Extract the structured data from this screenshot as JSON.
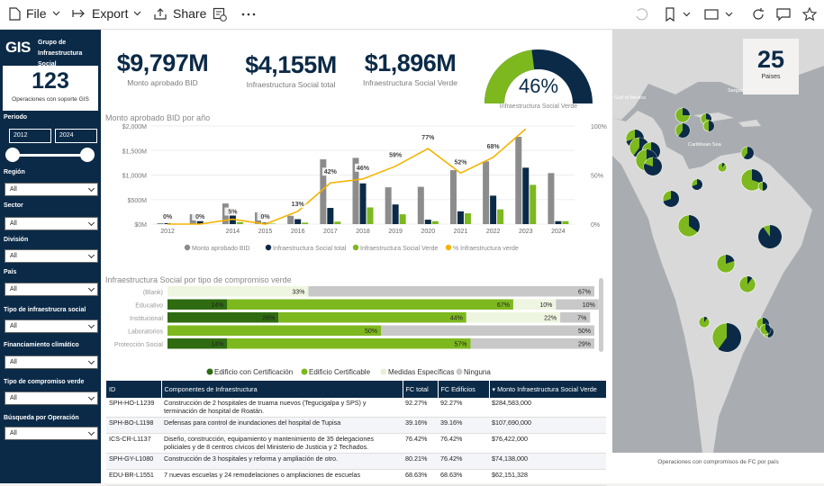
{
  "toolbar": {
    "file": "File",
    "export": "Export",
    "share": "Share"
  },
  "sidebar": {
    "logo": "GIS",
    "group": "Grupo de Infraestructura Social",
    "ops_value": "123",
    "ops_label": "Operaciones con soporte GIS",
    "periodo": "Periodo",
    "year_from": "2012",
    "year_to": "2024",
    "filters": [
      {
        "label": "Región",
        "value": "All"
      },
      {
        "label": "Sector",
        "value": "All"
      },
      {
        "label": "División",
        "value": "All"
      },
      {
        "label": "País",
        "value": "All"
      },
      {
        "label": "Tipo de infraestrucra social",
        "value": "All"
      },
      {
        "label": "Financiamiento climático",
        "value": "All"
      },
      {
        "label": "Tipo de compromiso verde",
        "value": "All"
      },
      {
        "label": "Búsqueda por Operación",
        "value": "All"
      }
    ]
  },
  "kpis": [
    {
      "value": "$9,797M",
      "label": "Monto aprobado BID"
    },
    {
      "value": "$4,155M",
      "label": "Infraestructura Social total"
    },
    {
      "value": "$1,896M",
      "label": "Infraestructura Social Verde"
    }
  ],
  "gauge": {
    "value": "46%",
    "label": "Infraestructura Social Verde",
    "fraction": 0.46
  },
  "bar_title": "Monto aprobado BID por año",
  "stack_title": "Infraestructura Social por tipo de compromiso verde",
  "map": {
    "count": "25",
    "count_label": "Paises",
    "caption": "Operaciones con compromisos de FC por país",
    "labels": [
      "Gulf of Mexico",
      "Sargasso Sea",
      "Caribbean Sea"
    ]
  },
  "colors": {
    "gray": "#8c8c8c",
    "navy": "#0b2a47",
    "green": "#7db81f",
    "orange": "#f4b400",
    "dkgreen": "#2f6b10",
    "pale": "#eef5e0",
    "lightgray": "#c8c8c8"
  },
  "chart_data": [
    {
      "type": "bar",
      "title": "Monto aprobado BID por año",
      "categories": [
        "2012",
        "2013",
        "2014",
        "2015",
        "2016",
        "2017",
        "2018",
        "2019",
        "2020",
        "2021",
        "2022",
        "2023",
        "2024"
      ],
      "x_tick_labels": [
        "2012",
        "2014",
        "2015",
        "2016",
        "2017",
        "2018",
        "2019",
        "2020",
        "2021",
        "2022",
        "2023",
        "2024"
      ],
      "y_ticks": [
        "$0M",
        "$500M",
        "$1,000M",
        "$1,500M",
        "$2,000M"
      ],
      "y2_ticks": [
        "0%",
        "50%",
        "100%"
      ],
      "ylim": [
        0,
        2000
      ],
      "series": [
        {
          "name": "Monto aprobado BID",
          "values": [
            20,
            200,
            420,
            240,
            170,
            1320,
            1350,
            750,
            760,
            1100,
            1280,
            1780,
            1040
          ]
        },
        {
          "name": "Infraestructura Social total",
          "values": [
            20,
            60,
            180,
            30,
            100,
            330,
            830,
            400,
            90,
            260,
            580,
            1150,
            60
          ]
        },
        {
          "name": "Infraestructura Social Verde",
          "values": [
            0,
            0,
            40,
            10,
            30,
            50,
            340,
            200,
            60,
            220,
            300,
            800,
            60
          ]
        },
        {
          "name": "% Infraestructura verde",
          "values": [
            0,
            0,
            5,
            0,
            13,
            42,
            46,
            59,
            77,
            52,
            68,
            97,
            null
          ]
        }
      ],
      "pct_labels": [
        "0%",
        "0%",
        "5%",
        "0%",
        "13%",
        "42%",
        "46%",
        "59%",
        "77%",
        "52%",
        "68%",
        "97%"
      ]
    },
    {
      "type": "bar",
      "title": "Infraestructura Social por tipo de compromiso verde",
      "categories": [
        "(Blank)",
        "Educativo",
        "Institucional",
        "Laboratorios",
        "Protección Social"
      ],
      "series": [
        {
          "name": "Edificio con Certificación",
          "values": [
            0,
            14,
            26,
            0,
            14
          ]
        },
        {
          "name": "Edificio Certificable",
          "values": [
            0,
            67,
            44,
            50,
            57
          ]
        },
        {
          "name": "Medidas Específicas",
          "values": [
            33,
            10,
            22,
            0,
            0
          ]
        },
        {
          "name": "Ninguna",
          "values": [
            67,
            10,
            7,
            50,
            29
          ]
        }
      ]
    }
  ],
  "table": {
    "headers": [
      "ID",
      "Componentes de Infraestructura",
      "FC total",
      "FC Edificios",
      "Monto Infraestructura Social Verde"
    ],
    "rows": [
      [
        "SPH-HO-L1239",
        "Construcción de 2 hospitales de truama nuevos (Tegucigalpa y SPS) y terminación de hospital de Roatán.",
        "92.27%",
        "92.27%",
        "$284,583,000"
      ],
      [
        "SPH-BO-L1198",
        "Defensas para control de inundaciones del hospital de Tupisa",
        "39.16%",
        "39.16%",
        "$107,690,000"
      ],
      [
        "ICS-CR-L1137",
        "Diseño, construcción, equipamiento y mantenimiento de 35 delegaciones policiales y de 8 centros cívicos del Ministerio de Justicia y 2 Techados.",
        "76.42%",
        "76.42%",
        "$76,422,000"
      ],
      [
        "SPH-GY-L1080",
        "Construcción de 3 hospitales y reforma y ampliación de otro.",
        "80.21%",
        "76.42%",
        "$74,138,000"
      ],
      [
        "EDU-BR-L1551",
        "7 nuevas escuelas y 24 remodelaciones o ampliaciones de escuelas",
        "68.63%",
        "68.63%",
        "$62,151,328"
      ]
    ]
  }
}
